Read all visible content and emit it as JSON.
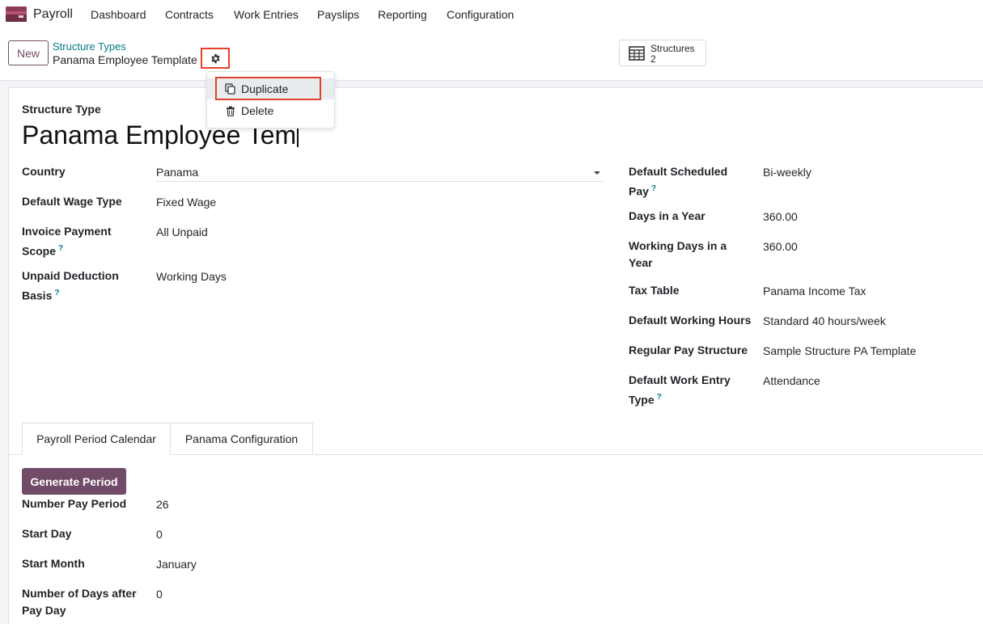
{
  "navbar": {
    "app_name": "Payroll",
    "menu": [
      "Dashboard",
      "Contracts",
      "Work Entries",
      "Payslips",
      "Reporting",
      "Configuration"
    ]
  },
  "control_panel": {
    "new_label": "New",
    "breadcrumb_parent": "Structure Types",
    "breadcrumb_current": "Panama Employee Template",
    "stat_button": {
      "label": "Structures",
      "value": "2"
    }
  },
  "action_menu": {
    "items": [
      "Duplicate",
      "Delete"
    ]
  },
  "form": {
    "title_label": "Structure Type",
    "name": "Panama Employee Tem",
    "left": {
      "country_label": "Country",
      "country_value": "Panama",
      "wage_type_label": "Default Wage Type",
      "wage_type_value": "Fixed Wage",
      "invoice_scope_label_1": "Invoice Payment",
      "invoice_scope_label_2": "Scope",
      "invoice_scope_value": "All Unpaid",
      "unpaid_basis_label_1": "Unpaid Deduction",
      "unpaid_basis_label_2": "Basis",
      "unpaid_basis_value": "Working Days"
    },
    "right": {
      "sched_pay_label_1": "Default Scheduled",
      "sched_pay_label_2": "Pay",
      "sched_pay_value": "Bi-weekly",
      "days_year_label": "Days in a Year",
      "days_year_value": "360.00",
      "work_days_label_1": "Working Days in a",
      "work_days_label_2": "Year",
      "work_days_value": "360.00",
      "tax_table_label": "Tax Table",
      "tax_table_value": "Panama Income Tax",
      "work_hours_label": "Default Working Hours",
      "work_hours_value": "Standard 40 hours/week",
      "pay_structure_label": "Regular Pay Structure",
      "pay_structure_value": "Sample Structure PA Template",
      "work_entry_label_1": "Default Work Entry",
      "work_entry_label_2": "Type",
      "work_entry_value": "Attendance"
    },
    "help_mark": "?"
  },
  "tabs": [
    "Payroll Period Calendar",
    "Panama Configuration"
  ],
  "calendar": {
    "generate_label": "Generate Period",
    "num_pay_period_label": "Number Pay Period",
    "num_pay_period_value": "26",
    "start_day_label": "Start Day",
    "start_day_value": "0",
    "start_month_label": "Start Month",
    "start_month_value": "January",
    "days_after_label_1": "Number of Days after",
    "days_after_label_2": "Pay Day",
    "days_after_value": "0"
  }
}
